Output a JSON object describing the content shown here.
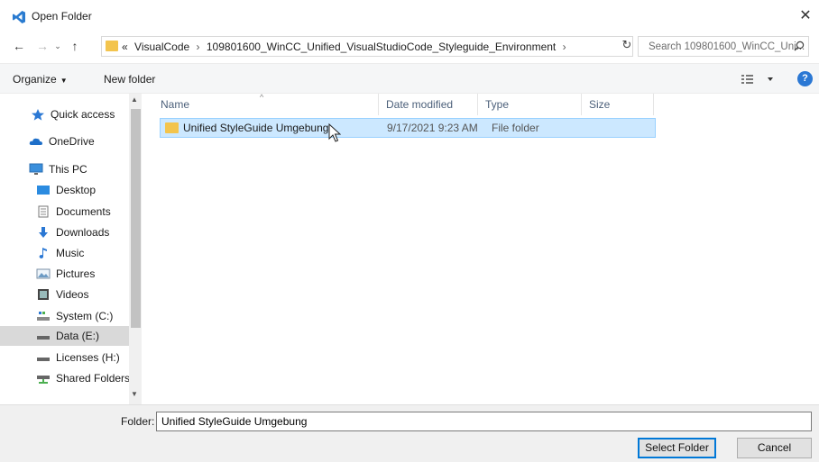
{
  "window": {
    "title": "Open Folder",
    "close_glyph": "✕"
  },
  "nav": {
    "back_glyph": "←",
    "forward_glyph": "→",
    "recent_glyph": "⌄",
    "up_glyph": "↑",
    "refresh_glyph": "↻",
    "dropdown_glyph": "⌄"
  },
  "address": {
    "prefix": "«",
    "crumbs": [
      "VisualCode",
      "109801600_WinCC_Unified_VisualStudioCode_Styleguide_Environment"
    ],
    "separator": "›"
  },
  "search": {
    "placeholder": "Search 109801600_WinCC_Uni..."
  },
  "toolbar": {
    "organize": "Organize",
    "new_folder": "New folder"
  },
  "sidebar": {
    "items": [
      {
        "label": "Quick access",
        "icon": "star-icon"
      },
      {
        "label": "OneDrive",
        "icon": "cloud-icon"
      },
      {
        "label": "This PC",
        "icon": "monitor-icon"
      },
      {
        "label": "Desktop",
        "icon": "desktop-icon"
      },
      {
        "label": "Documents",
        "icon": "document-icon"
      },
      {
        "label": "Downloads",
        "icon": "download-icon"
      },
      {
        "label": "Music",
        "icon": "music-icon"
      },
      {
        "label": "Pictures",
        "icon": "picture-icon"
      },
      {
        "label": "Videos",
        "icon": "video-icon"
      },
      {
        "label": "System (C:)",
        "icon": "system-drive-icon"
      },
      {
        "label": "Data (E:)",
        "icon": "drive-icon",
        "selected": true
      },
      {
        "label": "Licenses (H:)",
        "icon": "drive-icon"
      },
      {
        "label": "Shared Folders (\\",
        "icon": "network-drive-icon"
      }
    ]
  },
  "filelist": {
    "columns": [
      "Name",
      "Date modified",
      "Type",
      "Size"
    ],
    "rows": [
      {
        "name": "Unified StyleGuide Umgebung",
        "date": "9/17/2021 9:23 AM",
        "type": "File folder",
        "size": ""
      }
    ]
  },
  "footer": {
    "folder_label": "Folder:",
    "folder_value": "Unified StyleGuide Umgebung",
    "select_button": "Select Folder",
    "cancel_button": "Cancel"
  },
  "colors": {
    "accent": "#0078d7",
    "selection": "#cce8ff",
    "folder": "#f3c44d"
  }
}
